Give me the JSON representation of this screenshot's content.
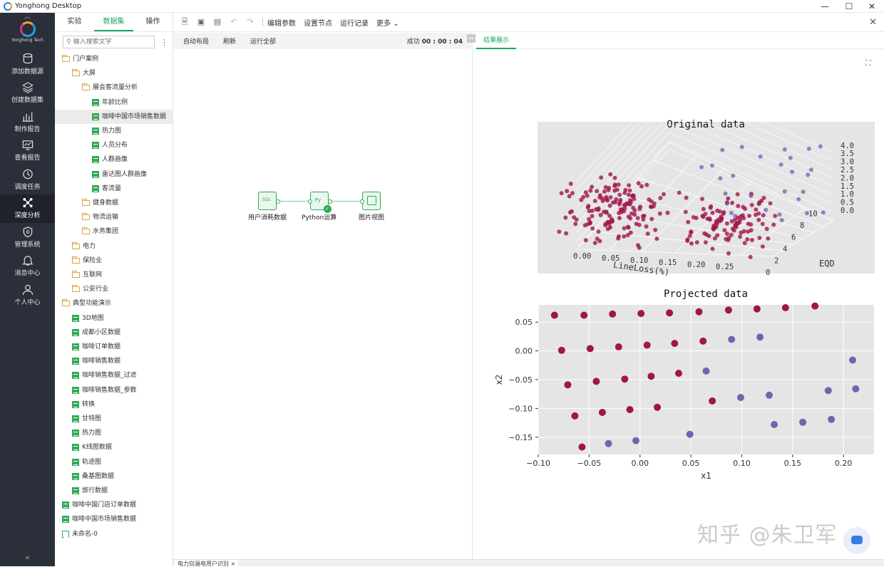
{
  "window": {
    "title": "Yonghong Desktop"
  },
  "sidebar": {
    "brand": "Yonghong Tech",
    "items": [
      {
        "label": "添加数据源",
        "icon": "database-icon"
      },
      {
        "label": "创建数据集",
        "icon": "layers-icon"
      },
      {
        "label": "制作报告",
        "icon": "bar-chart-icon"
      },
      {
        "label": "查看报告",
        "icon": "monitor-icon"
      },
      {
        "label": "调度任务",
        "icon": "clock-icon"
      },
      {
        "label": "深度分析",
        "icon": "network-icon"
      },
      {
        "label": "管理系统",
        "icon": "shield-icon"
      },
      {
        "label": "消息中心",
        "icon": "bell-icon"
      },
      {
        "label": "个人中心",
        "icon": "user-icon"
      }
    ],
    "collapse": "«"
  },
  "tree_panel": {
    "tabs": [
      "实验",
      "数据集",
      "操作"
    ],
    "active_tab": "数据集",
    "search_placeholder": "输入搜索文字",
    "items": [
      {
        "label": "门户案例",
        "type": "folder",
        "level": 0
      },
      {
        "label": "大屏",
        "type": "folder",
        "level": 1
      },
      {
        "label": "展会客流量分析",
        "type": "folder",
        "level": 2
      },
      {
        "label": "年龄比例",
        "type": "data",
        "level": 3
      },
      {
        "label": "咖啡中国市场销售数据",
        "type": "data",
        "level": 3,
        "selected": true
      },
      {
        "label": "热力图",
        "type": "data",
        "level": 3
      },
      {
        "label": "人员分布",
        "type": "data",
        "level": 3
      },
      {
        "label": "人群画像",
        "type": "data",
        "level": 3
      },
      {
        "label": "雷达图人群画像",
        "type": "data",
        "level": 3
      },
      {
        "label": "客流量",
        "type": "data",
        "level": 3
      },
      {
        "label": "健身数据",
        "type": "folder",
        "level": 2
      },
      {
        "label": "物流运输",
        "type": "folder",
        "level": 2
      },
      {
        "label": "水务集团",
        "type": "folder",
        "level": 2
      },
      {
        "label": "电力",
        "type": "folder",
        "level": 1
      },
      {
        "label": "保险业",
        "type": "folder",
        "level": 1
      },
      {
        "label": "互联网",
        "type": "folder",
        "level": 1
      },
      {
        "label": "公安行业",
        "type": "folder",
        "level": 1
      },
      {
        "label": "典型功能演示",
        "type": "folder",
        "level": 0
      },
      {
        "label": "3D地图",
        "type": "data",
        "level": 1
      },
      {
        "label": "成都小区数据",
        "type": "data",
        "level": 1
      },
      {
        "label": "咖啡订单数据",
        "type": "data",
        "level": 1
      },
      {
        "label": "咖啡销售数据",
        "type": "data",
        "level": 1
      },
      {
        "label": "咖啡销售数据_过滤",
        "type": "data",
        "level": 1
      },
      {
        "label": "咖啡销售数据_参数",
        "type": "data",
        "level": 1
      },
      {
        "label": "转换",
        "type": "data",
        "level": 1
      },
      {
        "label": "甘特图",
        "type": "data",
        "level": 1
      },
      {
        "label": "热力图",
        "type": "data",
        "level": 1
      },
      {
        "label": "K线图数据",
        "type": "data",
        "level": 1
      },
      {
        "label": "轨迹图",
        "type": "data",
        "level": 1
      },
      {
        "label": "桑基图数据",
        "type": "data",
        "level": 1
      },
      {
        "label": "旅行数据",
        "type": "data",
        "level": 1
      },
      {
        "label": "咖啡中国门店订单数据",
        "type": "data",
        "level": 0
      },
      {
        "label": "咖啡中国市场销售数据",
        "type": "data",
        "level": 0
      },
      {
        "label": "未命名-0",
        "type": "data-outline",
        "level": 0
      }
    ]
  },
  "toolbar": {
    "buttons": [
      "编辑参数",
      "设置节点",
      "运行记录",
      "更多"
    ],
    "more_caret": "⌄"
  },
  "canvas": {
    "actions": [
      "自动布局",
      "刷新",
      "运行全部"
    ],
    "status_label": "成功",
    "status_time": "00 : 00 : 04",
    "nodes": [
      {
        "label": "用户消耗数据",
        "kind": "sql"
      },
      {
        "label": "Python运算",
        "kind": "python",
        "done": true
      },
      {
        "label": "图片视图",
        "kind": "image"
      }
    ]
  },
  "result": {
    "tab": "结果展示"
  },
  "chart_data": [
    {
      "type": "scatter",
      "title": "Original data",
      "projection": "3d",
      "xlabel": "LineLoss(%)",
      "ylabel": "EQD",
      "zlabel": "",
      "x_ticks": [
        "0.00",
        "0.05",
        "0.10",
        "0.15",
        "0.20",
        "0.25"
      ],
      "y_ticks": [
        "0",
        "2",
        "4",
        "6",
        "8",
        "10"
      ],
      "z_ticks": [
        "0.0",
        "0.5",
        "1.0",
        "1.5",
        "2.0",
        "2.5",
        "3.0",
        "3.5",
        "4.0"
      ],
      "xlim": [
        0,
        0.28
      ],
      "ylim": [
        0,
        11
      ],
      "zlim": [
        0,
        4
      ],
      "colors": {
        "cluster_a": "#a0154b",
        "cluster_b": "#5b4fa6",
        "background": "#e5e5e5"
      },
      "approx_points": 300
    },
    {
      "type": "scatter",
      "title": "Projected data",
      "xlabel": "x1",
      "ylabel": "x2",
      "xlim": [
        -0.1,
        0.23
      ],
      "ylim": [
        -0.18,
        0.08
      ],
      "x_ticks": [
        "−0.10",
        "−0.05",
        "0.00",
        "0.05",
        "0.10",
        "0.15",
        "0.20"
      ],
      "y_ticks": [
        "0.05",
        "0.00",
        "−0.05",
        "−0.10",
        "−0.15"
      ],
      "colors": {
        "cluster_a": "#a0154b",
        "cluster_b": "#5b4fa6"
      },
      "series": [
        {
          "points": [
            [
              -0.084,
              0.062
            ],
            [
              -0.055,
              0.062
            ],
            [
              -0.027,
              0.064
            ],
            [
              0.001,
              0.065
            ],
            [
              0.029,
              0.066
            ],
            [
              0.058,
              0.068
            ],
            [
              0.087,
              0.071
            ],
            [
              0.115,
              0.073
            ],
            [
              0.143,
              0.075
            ],
            [
              0.172,
              0.078
            ],
            [
              -0.077,
              0.001
            ],
            [
              -0.049,
              0.004
            ],
            [
              -0.021,
              0.007
            ],
            [
              0.007,
              0.01
            ],
            [
              0.034,
              0.013
            ],
            [
              0.062,
              0.017
            ],
            [
              -0.071,
              -0.059
            ],
            [
              -0.043,
              -0.053
            ],
            [
              -0.015,
              -0.049
            ],
            [
              0.011,
              -0.044
            ],
            [
              0.038,
              -0.039
            ],
            [
              -0.064,
              -0.113
            ],
            [
              -0.037,
              -0.107
            ],
            [
              -0.01,
              -0.102
            ],
            [
              0.017,
              -0.098
            ],
            [
              0.071,
              -0.087
            ],
            [
              -0.057,
              -0.167
            ]
          ]
        },
        {
          "points": [
            [
              0.09,
              0.02
            ],
            [
              0.118,
              0.024
            ],
            [
              0.065,
              -0.035
            ],
            [
              0.099,
              -0.081
            ],
            [
              0.127,
              -0.077
            ],
            [
              0.185,
              -0.069
            ],
            [
              0.209,
              -0.016
            ],
            [
              0.212,
              -0.066
            ],
            [
              0.132,
              -0.128
            ],
            [
              0.16,
              -0.124
            ],
            [
              0.188,
              -0.119
            ],
            [
              0.049,
              -0.145
            ],
            [
              -0.031,
              -0.161
            ],
            [
              -0.004,
              -0.156
            ]
          ]
        }
      ]
    }
  ],
  "watermark": "知乎 @朱卫军",
  "bottom_tab": "电力窃漏电用户识别 ×"
}
